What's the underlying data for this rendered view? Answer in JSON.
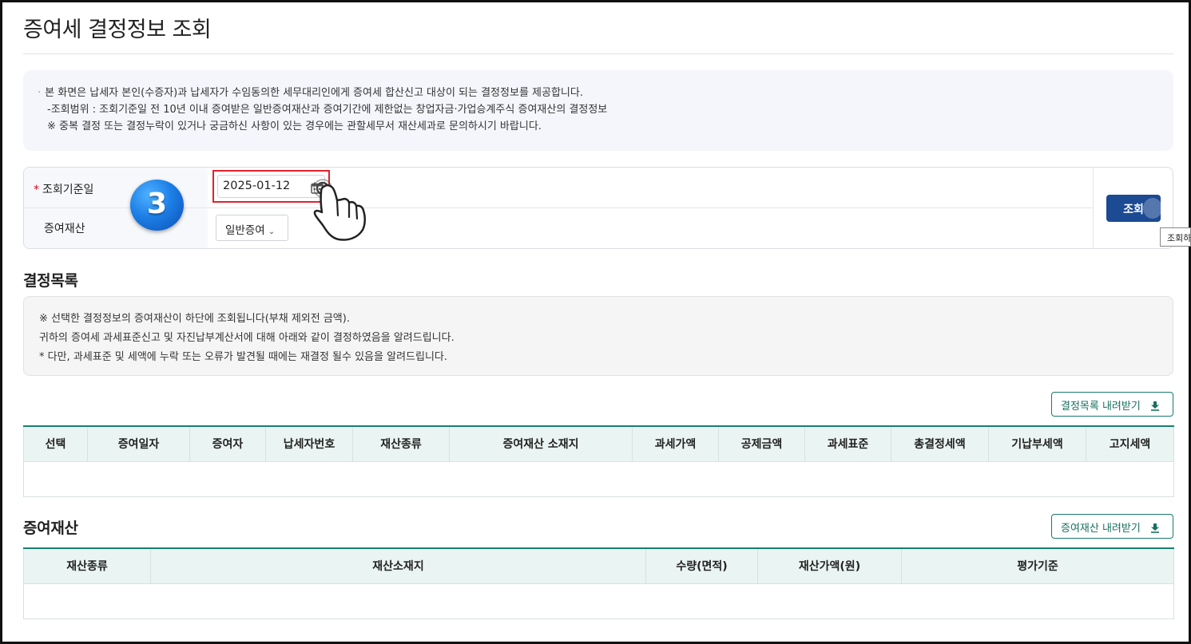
{
  "page": {
    "title": "증여세 결정정보 조회"
  },
  "notice": {
    "lines": [
      "본 화면은 납세자 본인(수증자)과 납세자가 수임동의한 세무대리인에게 증여세 합산신고 대상이 되는 결정정보를 제공합니다.",
      "-조회범위 : 조회기준일 전 10년 이내 증여받은 일반증여재산과 증여기간에 제한없는 창업자금·가업승계주식 증여재산의 결정정보",
      "※ 중복 결정 또는 결정누락이 있거나 궁금하신 사항이 있는 경우에는 관할세무서 재산세과로 문의하시기 바랍니다."
    ]
  },
  "search": {
    "date_label": "조회기준일",
    "required_mark": "*",
    "date_value": "2025-01-12",
    "asset_label": "증여재산",
    "asset_select": "일반증여",
    "query_button": "조회",
    "tooltip": "조회하"
  },
  "step_badge": "3",
  "decision": {
    "title": "결정목록",
    "info_lines": [
      "※ 선택한 결정정보의 증여재산이 하단에 조회됩니다(부채 제외전 금액).",
      "귀하의 증여세 과세표준신고 및 자진납부계산서에 대해 아래와 같이 결정하였음을 알려드립니다.",
      "* 다만, 과세표준 및 세액에 누락 또는 오류가 발견될 때에는 재결정 될수 있음을 알려드립니다."
    ],
    "download_button": "결정목록 내려받기",
    "columns": [
      "선택",
      "증여일자",
      "증여자",
      "납세자번호",
      "재산종류",
      "증여재산 소재지",
      "과세가액",
      "공제금액",
      "과세표준",
      "총결정세액",
      "기납부세액",
      "고지세액"
    ]
  },
  "assets": {
    "title": "증여재산",
    "download_button": "증여재산 내려받기",
    "columns": [
      "재산종류",
      "재산소재지",
      "수량(면적)",
      "재산가액(원)",
      "평가기준"
    ]
  },
  "colors": {
    "primary_button": "#1c4a93",
    "download_border": "#177a6b",
    "highlight": "#e0232b",
    "table_header": "#eaf4f2"
  }
}
